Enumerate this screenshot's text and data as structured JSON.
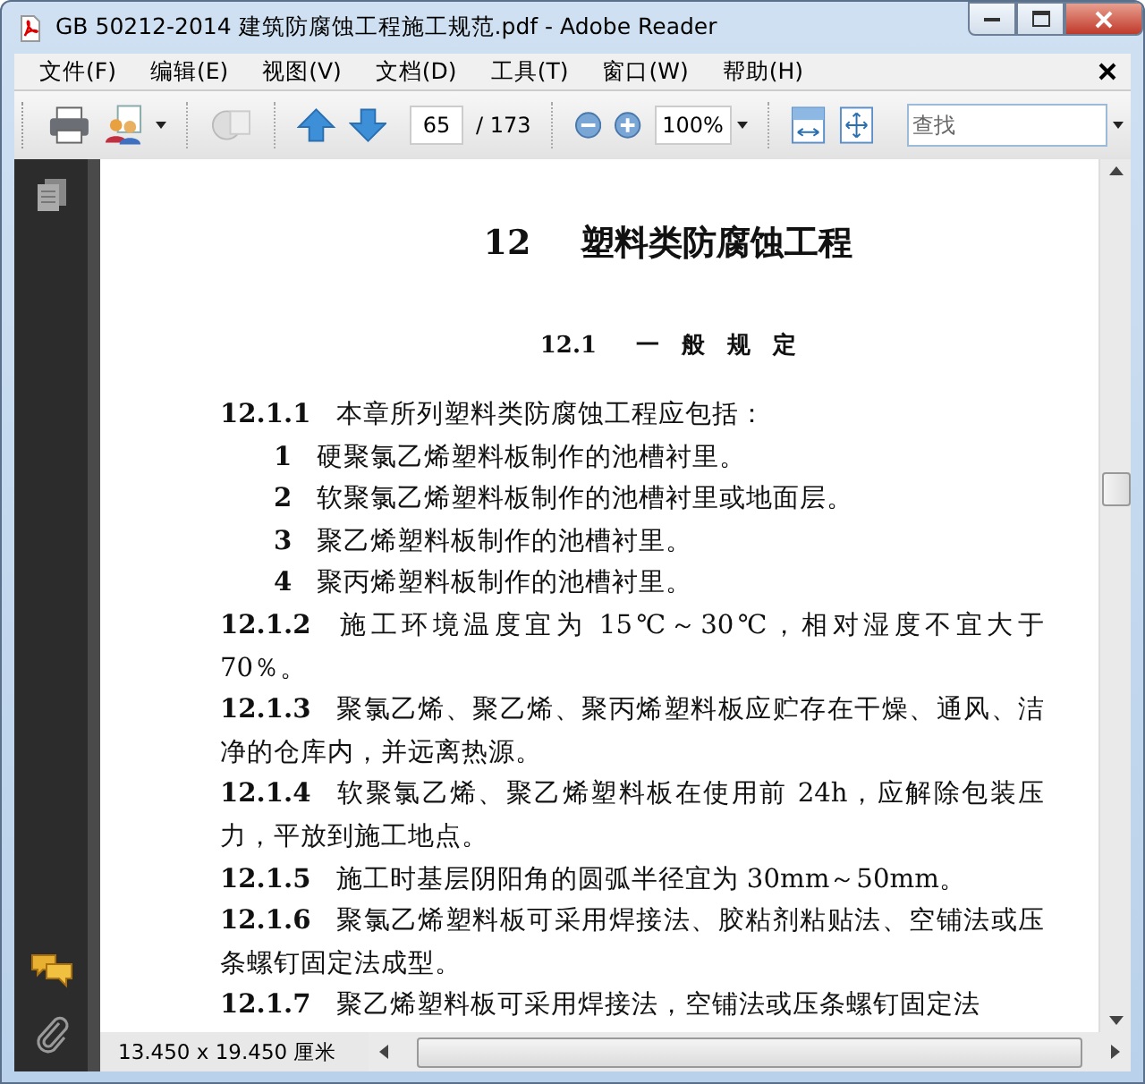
{
  "window": {
    "title": "GB 50212-2014 建筑防腐蚀工程施工规范.pdf - Adobe Reader"
  },
  "menu": [
    {
      "label": "文件(F)"
    },
    {
      "label": "编辑(E)"
    },
    {
      "label": "视图(V)"
    },
    {
      "label": "文档(D)"
    },
    {
      "label": "工具(T)"
    },
    {
      "label": "窗口(W)"
    },
    {
      "label": "帮助(H)"
    }
  ],
  "toolbar": {
    "page_value": "65",
    "page_total": "/ 173",
    "zoom_value": "100%",
    "search_placeholder": "查找"
  },
  "document": {
    "chapter_number": "12",
    "chapter_title": "塑料类防腐蚀工程",
    "section_number": "12.1",
    "section_title": "一 般 规 定",
    "paragraphs": [
      {
        "kind": "clause",
        "number": "12.1.1",
        "text": "本章所列塑料类防腐蚀工程应包括："
      },
      {
        "kind": "item",
        "number": "1",
        "text": "硬聚氯乙烯塑料板制作的池槽衬里。"
      },
      {
        "kind": "item",
        "number": "2",
        "text": "软聚氯乙烯塑料板制作的池槽衬里或地面层。"
      },
      {
        "kind": "item",
        "number": "3",
        "text": "聚乙烯塑料板制作的池槽衬里。"
      },
      {
        "kind": "item",
        "number": "4",
        "text": "聚丙烯塑料板制作的池槽衬里。"
      },
      {
        "kind": "clause",
        "number": "12.1.2",
        "text": "施工环境温度宜为 15℃～30℃，相对湿度不宜大于 70％。"
      },
      {
        "kind": "clause",
        "number": "12.1.3",
        "text": "聚氯乙烯、聚乙烯、聚丙烯塑料板应贮存在干燥、通风、洁净的仓库内，并远离热源。"
      },
      {
        "kind": "clause",
        "number": "12.1.4",
        "text": "软聚氯乙烯、聚乙烯塑料板在使用前 24h，应解除包装压力，平放到施工地点。"
      },
      {
        "kind": "clause",
        "number": "12.1.5",
        "text": "施工时基层阴阳角的圆弧半径宜为 30mm～50mm。"
      },
      {
        "kind": "clause",
        "number": "12.1.6",
        "text": "聚氯乙烯塑料板可采用焊接法、胶粘剂粘贴法、空铺法或压条螺钉固定法成型。"
      },
      {
        "kind": "clause",
        "number": "12.1.7",
        "text": "聚乙烯塑料板可采用焊接法，空铺法或压条螺钉固定法"
      }
    ]
  },
  "status_bar": {
    "page_size": "13.450 x 19.450 厘米"
  }
}
